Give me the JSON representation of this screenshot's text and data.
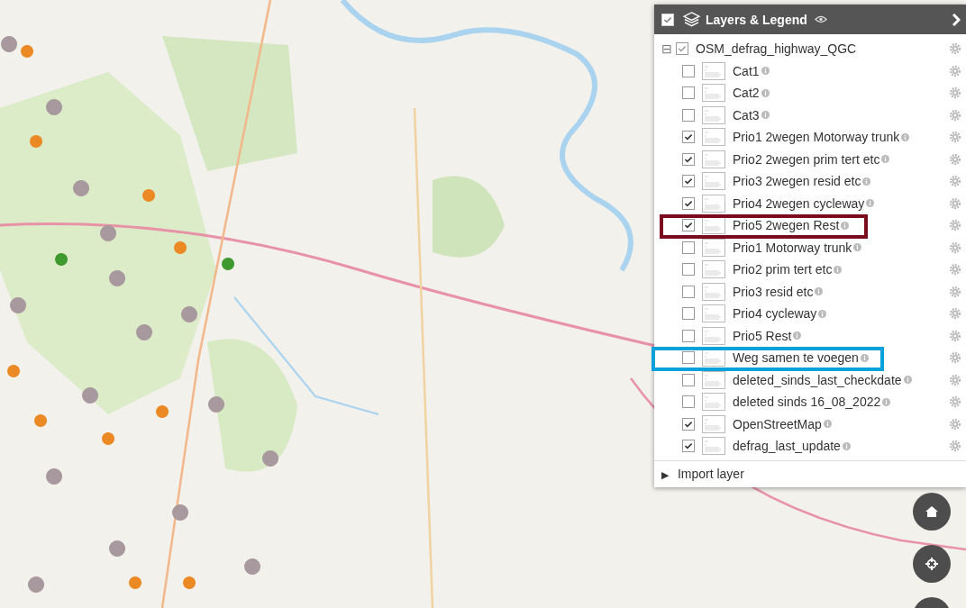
{
  "panel": {
    "title": "Layers & Legend",
    "visible_checked": true,
    "collapse_glyph": "⊟",
    "group": {
      "name": "OSM_defrag_highway_QGC",
      "checked": true,
      "expanded": true,
      "layers": [
        {
          "name": "Cat1",
          "checked": false
        },
        {
          "name": "Cat2",
          "checked": false
        },
        {
          "name": "Cat3",
          "checked": false
        },
        {
          "name": "Prio1 2wegen Motorway trunk",
          "checked": true
        },
        {
          "name": "Prio2 2wegen prim tert etc",
          "checked": true
        },
        {
          "name": "Prio3 2wegen resid etc",
          "checked": true
        },
        {
          "name": "Prio4 2wegen cycleway",
          "checked": true
        },
        {
          "name": "Prio5 2wegen Rest",
          "checked": true,
          "color": "#7b0a1e"
        },
        {
          "name": "Prio1 Motorway trunk",
          "checked": false
        },
        {
          "name": "Prio2 prim tert etc",
          "checked": false
        },
        {
          "name": "Prio3 resid etc",
          "checked": false
        },
        {
          "name": "Prio4 cycleway",
          "checked": false
        },
        {
          "name": "Prio5 Rest",
          "checked": false
        },
        {
          "name": "Weg samen te voegen",
          "checked": false,
          "color": "#0aa0dc"
        },
        {
          "name": "deleted_sinds_last_checkdate",
          "checked": false
        },
        {
          "name": "deleted sinds 16_08_2022",
          "checked": false
        },
        {
          "name": "OpenStreetMap",
          "checked": true
        },
        {
          "name": "defrag_last_update",
          "checked": true
        }
      ]
    },
    "import": {
      "glyph": "▶",
      "label": "Import layer"
    }
  },
  "map_buttons": [
    {
      "kind": "home"
    },
    {
      "kind": "locate"
    },
    {
      "kind": "blank"
    }
  ]
}
